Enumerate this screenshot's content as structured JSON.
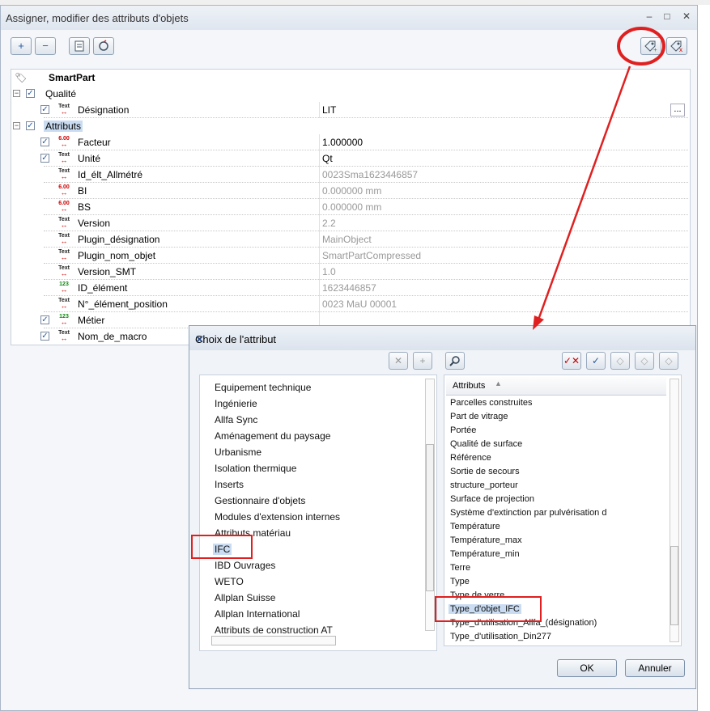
{
  "window": {
    "title": "Assigner, modifier des attributs d'objets",
    "minimize": "–",
    "maximize": "□",
    "close": "✕"
  },
  "toolbar": {
    "add": "+",
    "remove": "−"
  },
  "tree": {
    "root": "SmartPart",
    "groups": [
      {
        "label": "Qualité"
      },
      {
        "label": "Attributs"
      }
    ],
    "rows": [
      {
        "label": "Désignation",
        "value": "LIT",
        "browse": "..."
      },
      {
        "label": "Facteur",
        "value": "1.000000"
      },
      {
        "label": "Unité",
        "value": "Qt"
      },
      {
        "label": "Id_élt_Allmétré",
        "value": "0023Sma1623446857"
      },
      {
        "label": "BI",
        "value": "0.000000 mm"
      },
      {
        "label": "BS",
        "value": "0.000000 mm"
      },
      {
        "label": "Version",
        "value": "2.2"
      },
      {
        "label": "Plugin_désignation",
        "value": "MainObject"
      },
      {
        "label": "Plugin_nom_objet",
        "value": "SmartPartCompressed"
      },
      {
        "label": "Version_SMT",
        "value": "1.0"
      },
      {
        "label": "ID_élément",
        "value": "1623446857"
      },
      {
        "label": "N°_élément_position",
        "value": "0023 MaU 00001"
      },
      {
        "label": "Métier",
        "value": ""
      },
      {
        "label": "Nom_de_macro",
        "value": ""
      }
    ],
    "icon_text_top": "Text",
    "icon_num_top": "6.00",
    "icon_int_top": "123",
    "icon_bottom": "↔"
  },
  "dialog": {
    "title": "Choix de l'attribut",
    "close": "✕",
    "left_items": [
      "Equipement technique",
      "Ingénierie",
      "Allfa Sync",
      "Aménagement du paysage",
      "Urbanisme",
      "Isolation thermique",
      "Inserts",
      "Gestionnaire d'objets",
      "Modules d'extension internes",
      "Attributs matériau",
      "IFC",
      "IBD Ouvrages",
      "WETO",
      "Allplan Suisse",
      "Allplan International",
      "Attributs de construction AT"
    ],
    "right_header": "Attributs",
    "right_items": [
      "Parcelles construites",
      "Part de vitrage",
      "Portée",
      "Qualité de surface",
      "Référence",
      "Sortie de secours",
      "structure_porteur",
      "Surface de projection",
      "Système d'extinction par pulvérisation d",
      "Température",
      "Température_max",
      "Température_min",
      "Terre",
      "Type",
      "Type de verre",
      "Type_d'objet_IFC",
      "Type_d'utilisation_Allfa_(désignation)",
      "Type_d'utilisation_Din277"
    ],
    "ok": "OK",
    "cancel": "Annuler"
  },
  "colors": {
    "annotation": "#e02020",
    "selection": "#c9dcf2",
    "accent": "#2a5aa0"
  }
}
